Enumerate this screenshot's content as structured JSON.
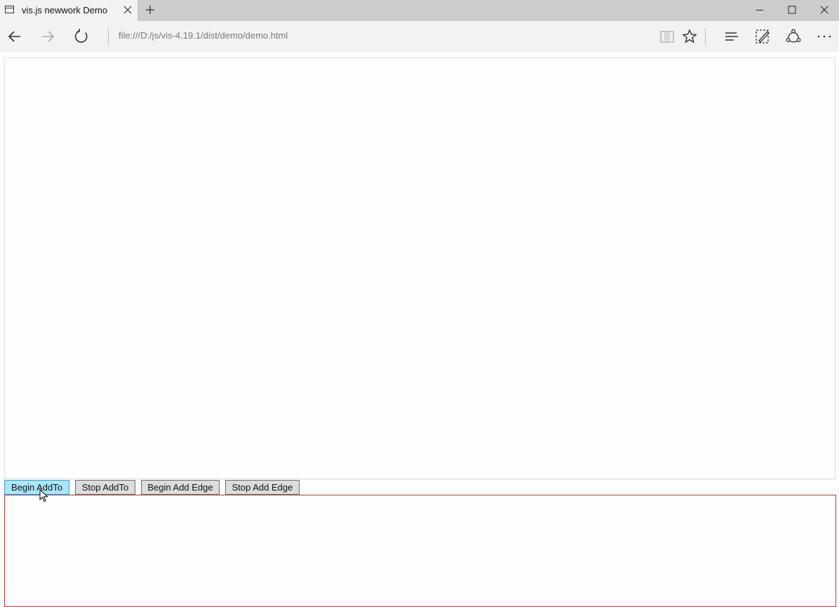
{
  "browser": {
    "tab_title": "vis.js newwork Demo",
    "address": "file:///D:/js/vis-4.19.1/dist/demo/demo.html",
    "icons": [
      "page-icon",
      "close-icon",
      "plus-icon",
      "minimize-icon",
      "maximize-icon",
      "window-close-icon",
      "back-icon",
      "forward-icon",
      "refresh-icon",
      "reading-view-icon",
      "favorite-star-icon",
      "hub-icon",
      "web-note-icon",
      "share-icon",
      "more-icon"
    ]
  },
  "controls": {
    "begin_addto": "Begin AddTo",
    "stop_addto": "Stop AddTo",
    "begin_add_edge": "Begin Add Edge",
    "stop_add_edge": "Stop Add Edge"
  },
  "colors": {
    "hover_button": "#a8e6f8",
    "output_border": "#d93030"
  }
}
